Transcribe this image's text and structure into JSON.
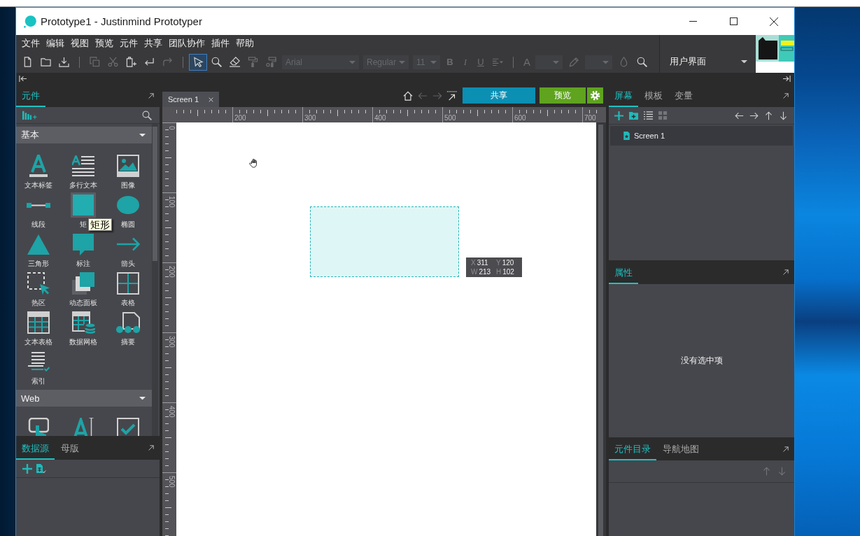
{
  "window": {
    "title": "Prototype1 - Justinmind Prototyper"
  },
  "menu": [
    "文件",
    "编辑",
    "视图",
    "预览",
    "元件",
    "共享",
    "团队协作",
    "插件",
    "帮助"
  ],
  "toolbar": {
    "groups": [
      [
        {
          "kind": "button",
          "disabled": false,
          "selected": false
        },
        {
          "kind": "button",
          "disabled": false,
          "selected": false
        },
        {
          "kind": "button",
          "disabled": false,
          "selected": false
        }
      ],
      [
        {
          "kind": "button",
          "disabled": true,
          "selected": false
        },
        {
          "kind": "button",
          "disabled": true,
          "selected": false
        },
        {
          "kind": "button",
          "disabled": false,
          "selected": false
        },
        {
          "kind": "button",
          "disabled": false,
          "selected": false
        },
        {
          "kind": "button",
          "disabled": true,
          "selected": false
        }
      ],
      [
        {
          "kind": "button",
          "disabled": false,
          "selected": true
        },
        {
          "kind": "button",
          "disabled": false,
          "selected": false
        },
        {
          "kind": "button",
          "disabled": false,
          "selected": false
        },
        {
          "kind": "button",
          "disabled": true,
          "selected": false
        },
        {
          "kind": "button",
          "disabled": true,
          "selected": false
        },
        {
          "kind": "dropdown",
          "value": "Arial",
          "disabled": true,
          "selected": false
        },
        {
          "kind": "dropdown",
          "value": "Regular",
          "disabled": true,
          "selected": false
        },
        {
          "kind": "dropdown",
          "value": "11",
          "disabled": true,
          "selected": false
        },
        {
          "kind": "bold",
          "label": "B",
          "disabled": true,
          "selected": false
        },
        {
          "kind": "italic",
          "label": "I",
          "disabled": true,
          "selected": false
        },
        {
          "kind": "underline",
          "label": "U",
          "disabled": true,
          "selected": false
        },
        {
          "kind": "button",
          "disabled": true,
          "selected": false
        }
      ],
      [
        {
          "kind": "letter",
          "label": "A",
          "disabled": true,
          "selected": false
        },
        {
          "kind": "dropdown",
          "disabled": true,
          "selected": false
        },
        {
          "kind": "button",
          "disabled": true,
          "selected": false
        },
        {
          "kind": "dropdown",
          "disabled": true,
          "selected": false
        },
        {
          "kind": "button",
          "disabled": true,
          "selected": false
        },
        {
          "kind": "button",
          "disabled": false,
          "selected": false
        }
      ]
    ]
  },
  "workspace": {
    "value": "用户界面"
  },
  "components_panel": {
    "tabs": [
      {
        "label": "元件",
        "selected": true
      }
    ],
    "sections": [
      {
        "title": "基本",
        "expanded": true,
        "items": [
          {
            "label": "文本标签",
            "hovered": false
          },
          {
            "label": "多行文本",
            "hovered": false
          },
          {
            "label": "图像",
            "hovered": false
          },
          {
            "label": "线段",
            "hovered": false
          },
          {
            "label": "矩",
            "hovered": true
          },
          {
            "label": "椭圆",
            "hovered": false
          },
          {
            "label": "三角形",
            "hovered": false
          },
          {
            "label": "标注",
            "hovered": false
          },
          {
            "label": "箭头",
            "hovered": false
          },
          {
            "label": "热区",
            "hovered": false
          },
          {
            "label": "动态面板",
            "hovered": false
          },
          {
            "label": "表格",
            "hovered": false
          },
          {
            "label": "文本表格",
            "hovered": false
          },
          {
            "label": "数据网格",
            "hovered": false
          },
          {
            "label": "摘要",
            "hovered": false
          },
          {
            "label": "索引",
            "hovered": false
          }
        ]
      },
      {
        "title": "Web",
        "expanded": true,
        "items": [
          {
            "hovered": false
          },
          {
            "hovered": false
          },
          {
            "hovered": false
          }
        ]
      }
    ],
    "tooltip": "矩形"
  },
  "data_panel": {
    "tabs": [
      {
        "label": "数据源",
        "selected": true
      },
      {
        "label": "母版",
        "selected": false
      }
    ]
  },
  "editor": {
    "tabs": [
      {
        "label": "Screen 1",
        "selected": true
      }
    ],
    "nav": [
      {
        "disabled": false
      },
      {
        "disabled": true
      },
      {
        "disabled": true
      },
      {
        "disabled": false
      }
    ],
    "share_button": "共享",
    "preview_button": "预览",
    "ruler": {
      "x_labels": [
        "200",
        "300",
        "400",
        "500",
        "600",
        "700"
      ],
      "y_labels": [
        "0",
        "100",
        "200",
        "300",
        "400",
        "500"
      ]
    },
    "canvas": {
      "shapes": [
        {
          "kind": "rectangle"
        }
      ],
      "size_readout": [
        {
          "label": "X",
          "value": "311"
        },
        {
          "label": "Y",
          "value": "120"
        },
        {
          "label": "W",
          "value": "213"
        },
        {
          "label": "H",
          "value": "102"
        }
      ]
    }
  },
  "screens_panel": {
    "tabs": [
      {
        "label": "屏幕",
        "selected": true
      },
      {
        "label": "模板",
        "selected": false
      },
      {
        "label": "变量",
        "selected": false
      }
    ],
    "tools": [
      {
        "disabled": false
      },
      {
        "disabled": false
      },
      {
        "disabled": false
      },
      {
        "disabled": true
      },
      {
        "disabled": false
      },
      {
        "disabled": false
      },
      {
        "disabled": false
      },
      {
        "disabled": false
      }
    ],
    "screens": [
      {
        "label": "Screen 1",
        "selected": true
      }
    ]
  },
  "properties_panel": {
    "tabs": [
      {
        "label": "属性",
        "selected": true
      }
    ],
    "empty_message": "没有选中项"
  },
  "outline_panel": {
    "tabs": [
      {
        "label": "元件目录",
        "selected": true
      },
      {
        "label": "导航地图",
        "selected": false
      }
    ],
    "tools": [
      {
        "disabled": true
      },
      {
        "disabled": true
      }
    ]
  }
}
